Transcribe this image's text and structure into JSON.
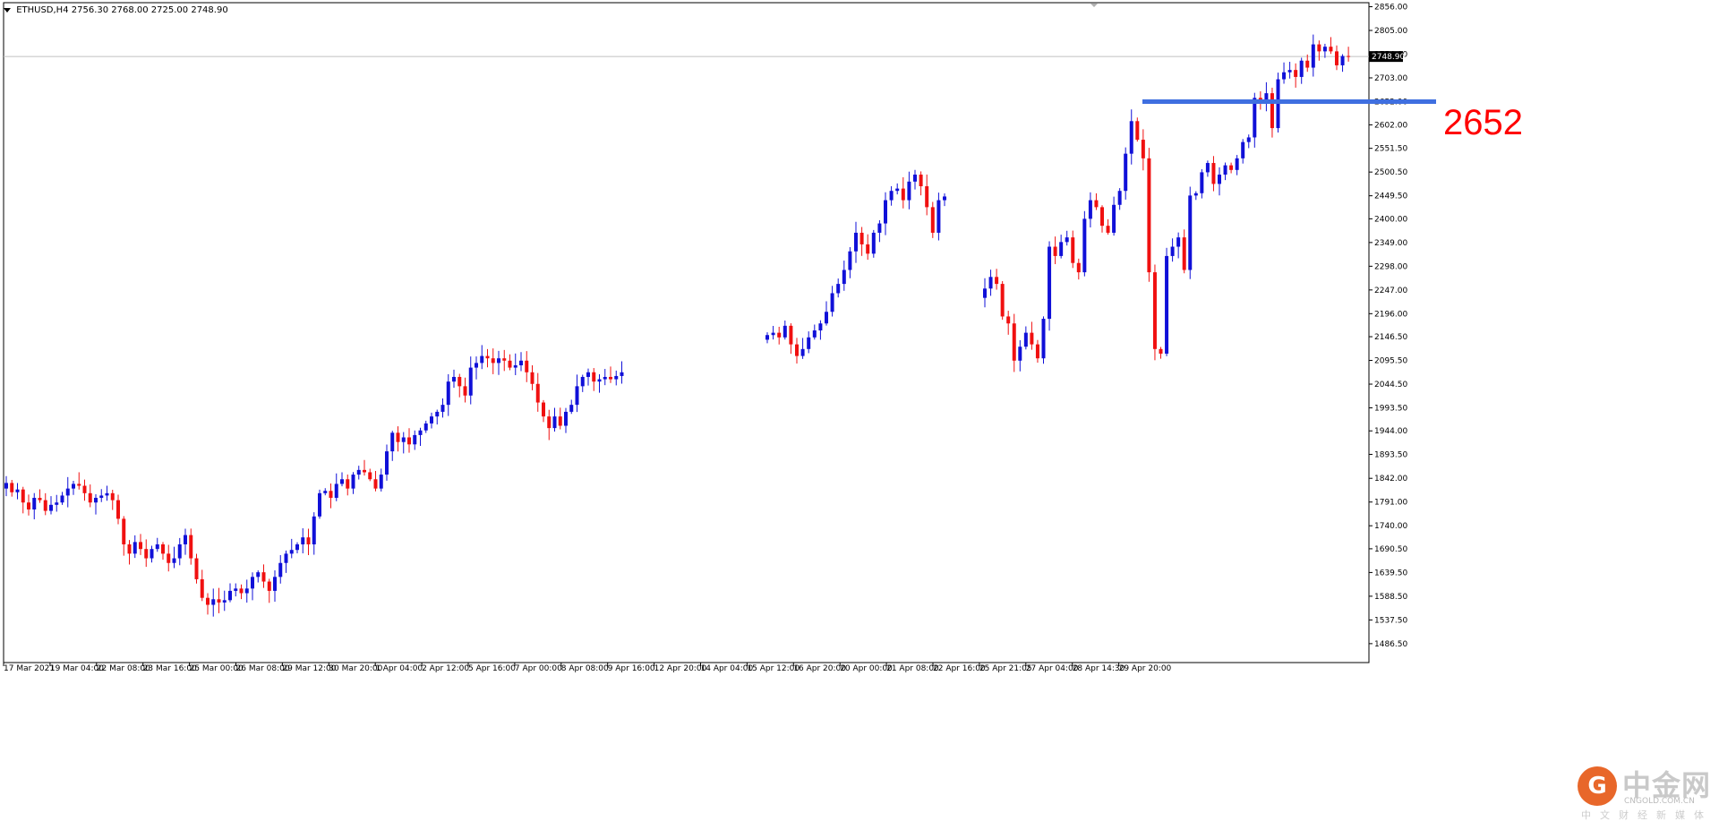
{
  "header": {
    "symbol_info": "ETHUSD,H4  2756.30 2768.00 2725.00 2748.90"
  },
  "annotation": {
    "level_label": "2652",
    "level_color": "#3f6fe0",
    "level_label_color": "#ff0000"
  },
  "logo": {
    "mark": "G",
    "cn_name": "中金网",
    "en_name": "CNGOLD.COM.CN",
    "sub": "中文财经新媒体"
  },
  "colors": {
    "bull": "#1010d8",
    "bear": "#f01010",
    "grid_line": "#c0c0c0",
    "axis_text": "#000000",
    "current_price_box": "#000000"
  },
  "chart_data": {
    "type": "candlestick",
    "title": "ETHUSD,H4",
    "symbol": "ETHUSD",
    "timeframe": "H4",
    "ohlc_readout": {
      "open": 2756.3,
      "high": 2768.0,
      "low": 2725.0,
      "close": 2748.9
    },
    "current_price": 2748.9,
    "current_price_label": "2748.90",
    "horizontal_level": 2652,
    "ylim": [
      1454.5,
      2856.0
    ],
    "y_ticks": [
      "2856.00",
      "2805.00",
      "2754.00",
      "2703.00",
      "2652.00",
      "2602.00",
      "2551.50",
      "2500.50",
      "2449.50",
      "2400.00",
      "2349.00",
      "2298.00",
      "2247.00",
      "2196.00",
      "2146.50",
      "2095.50",
      "2044.50",
      "1993.50",
      "1944.00",
      "1893.50",
      "1842.00",
      "1791.00",
      "1740.00",
      "1690.50",
      "1639.50",
      "1588.50",
      "1537.50",
      "1486.50"
    ],
    "x_ticks": [
      "17 Mar 2021",
      "19 Mar 04:00",
      "22 Mar 08:00",
      "23 Mar 16:00",
      "25 Mar 00:00",
      "26 Mar 08:00",
      "29 Mar 12:00",
      "30 Mar 20:00",
      "1 Apr 04:00",
      "2 Apr 12:00",
      "5 Apr 16:00",
      "7 Apr 00:00",
      "8 Apr 08:00",
      "9 Apr 16:00",
      "12 Apr 20:00",
      "14 Apr 04:00",
      "15 Apr 12:00",
      "16 Apr 20:00",
      "20 Apr 00:00",
      "21 Apr 08:00",
      "22 Apr 16:00",
      "25 Apr 21:05",
      "27 Apr 04:00",
      "28 Apr 14:30",
      "29 Apr 20:00"
    ],
    "segments": [
      {
        "start_price": 1820,
        "closes": [
          1832,
          1812,
          1818,
          1790,
          1775,
          1800,
          1795,
          1772,
          1785,
          1790,
          1805,
          1820,
          1830,
          1826,
          1810,
          1790,
          1800,
          1805,
          1810,
          1795,
          1755,
          1700,
          1680,
          1705,
          1690,
          1670,
          1690,
          1700,
          1680,
          1660,
          1670,
          1700,
          1720,
          1670,
          1625,
          1585,
          1570,
          1582,
          1575,
          1580,
          1600,
          1605,
          1595,
          1605,
          1630,
          1640,
          1620,
          1600,
          1630,
          1660,
          1680,
          1688,
          1700,
          1715,
          1700,
          1760,
          1810,
          1815,
          1800,
          1830,
          1840,
          1820,
          1850,
          1860,
          1855,
          1840,
          1820,
          1850,
          1900,
          1940,
          1920,
          1930,
          1915,
          1935,
          1945,
          1960,
          1975,
          1985,
          2000,
          2050,
          2060,
          2040,
          2020,
          2080,
          2090,
          2105,
          2100,
          2090,
          2100,
          2095,
          2080,
          2085,
          2095,
          2070,
          2045,
          2005,
          1975,
          1950,
          1975,
          1955,
          1985,
          2000,
          2040,
          2060,
          2070,
          2050,
          2055,
          2060,
          2055,
          2062,
          2070
        ]
      },
      {
        "start_price": 2140,
        "closes": [
          2150,
          2155,
          2145,
          2170,
          2130,
          2105,
          2120,
          2145,
          2160,
          2175,
          2200,
          2240,
          2260,
          2290,
          2330,
          2370,
          2345,
          2325,
          2370,
          2390,
          2440,
          2460,
          2465,
          2440,
          2480,
          2495,
          2470,
          2425,
          2370,
          2440,
          2448
        ]
      },
      {
        "start_price": 2230,
        "closes": [
          2250,
          2275,
          2260,
          2190,
          2175,
          2095,
          2125,
          2155,
          2130,
          2100,
          2185,
          2340,
          2320,
          2350,
          2360,
          2305,
          2285,
          2400,
          2440,
          2425,
          2385,
          2370,
          2430,
          2460,
          2540,
          2610,
          2570,
          2530,
          2285,
          2120,
          2110,
          2320,
          2340,
          2360,
          2290,
          2450,
          2455,
          2500,
          2520,
          2475,
          2495,
          2515,
          2505,
          2530,
          2565,
          2575,
          2660,
          2650,
          2670,
          2595,
          2700,
          2715,
          2720,
          2705,
          2740,
          2725,
          2775,
          2760,
          2770,
          2760,
          2730,
          2750,
          2748.9
        ]
      }
    ]
  }
}
